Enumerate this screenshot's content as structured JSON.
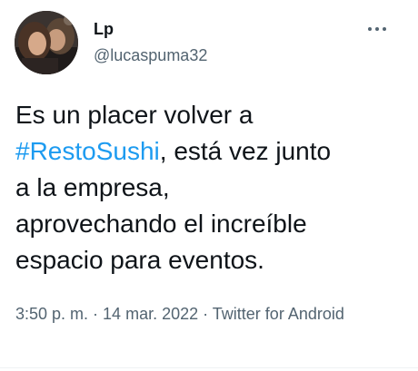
{
  "author": {
    "display_name": "Lp",
    "handle": "@lucaspuma32"
  },
  "tweet": {
    "text_before": "Es un placer volver a\n",
    "hashtag": "#RestoSushi",
    "text_after": ", está vez junto\na la empresa,\naprovechando el increíble\nespacio para eventos."
  },
  "meta": {
    "time": "3:50 p. m.",
    "separator": " · ",
    "date": "14 mar. 2022",
    "source": "Twitter for Android"
  },
  "icons": {
    "more": "more-horizontal-icon"
  },
  "colors": {
    "link": "#1d9bf0",
    "text": "#0f1419",
    "secondary": "#536471"
  }
}
